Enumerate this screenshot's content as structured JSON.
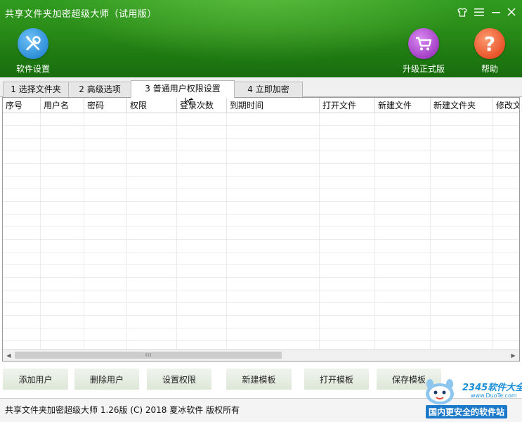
{
  "window": {
    "title": "共享文件夹加密超级大师（试用版）",
    "controls": [
      "shirt-icon",
      "menu-icon",
      "minimize-icon",
      "close-icon"
    ]
  },
  "toolbar": {
    "settings_label": "软件设置",
    "upgrade_label": "升级正式版",
    "help_label": "帮助",
    "help_glyph": "?"
  },
  "tabs": [
    {
      "label": "1 选择文件夹",
      "active": false
    },
    {
      "label": "2 高级选项",
      "active": false
    },
    {
      "label": "3 普通用户权限设置",
      "active": true
    },
    {
      "label": "4 立即加密",
      "active": false
    }
  ],
  "grid": {
    "columns": [
      "序号",
      "用户名",
      "密码",
      "权限",
      "登录次数",
      "到期时间",
      "打开文件",
      "新建文件",
      "新建文件夹",
      "修改文"
    ],
    "rows": [],
    "scroll_grip": "III"
  },
  "buttons": {
    "add_user": "添加用户",
    "delete_user": "删除用户",
    "set_permission": "设置权限",
    "new_template": "新建模板",
    "open_template": "打开模板",
    "save_template": "保存模板"
  },
  "status": {
    "text": "共享文件夹加密超级大师 1.26版 (C) 2018 夏冰软件 版权所有"
  },
  "watermark": {
    "brand": "2345软件大全",
    "url": "www.DuoTe.com",
    "slogan": "国内更安全的软件站"
  },
  "colors": {
    "header_green": "#2b8e19",
    "settings_blue": "#2f8fd8",
    "upgrade_purple": "#a43fc6",
    "help_orange": "#e8542a"
  }
}
